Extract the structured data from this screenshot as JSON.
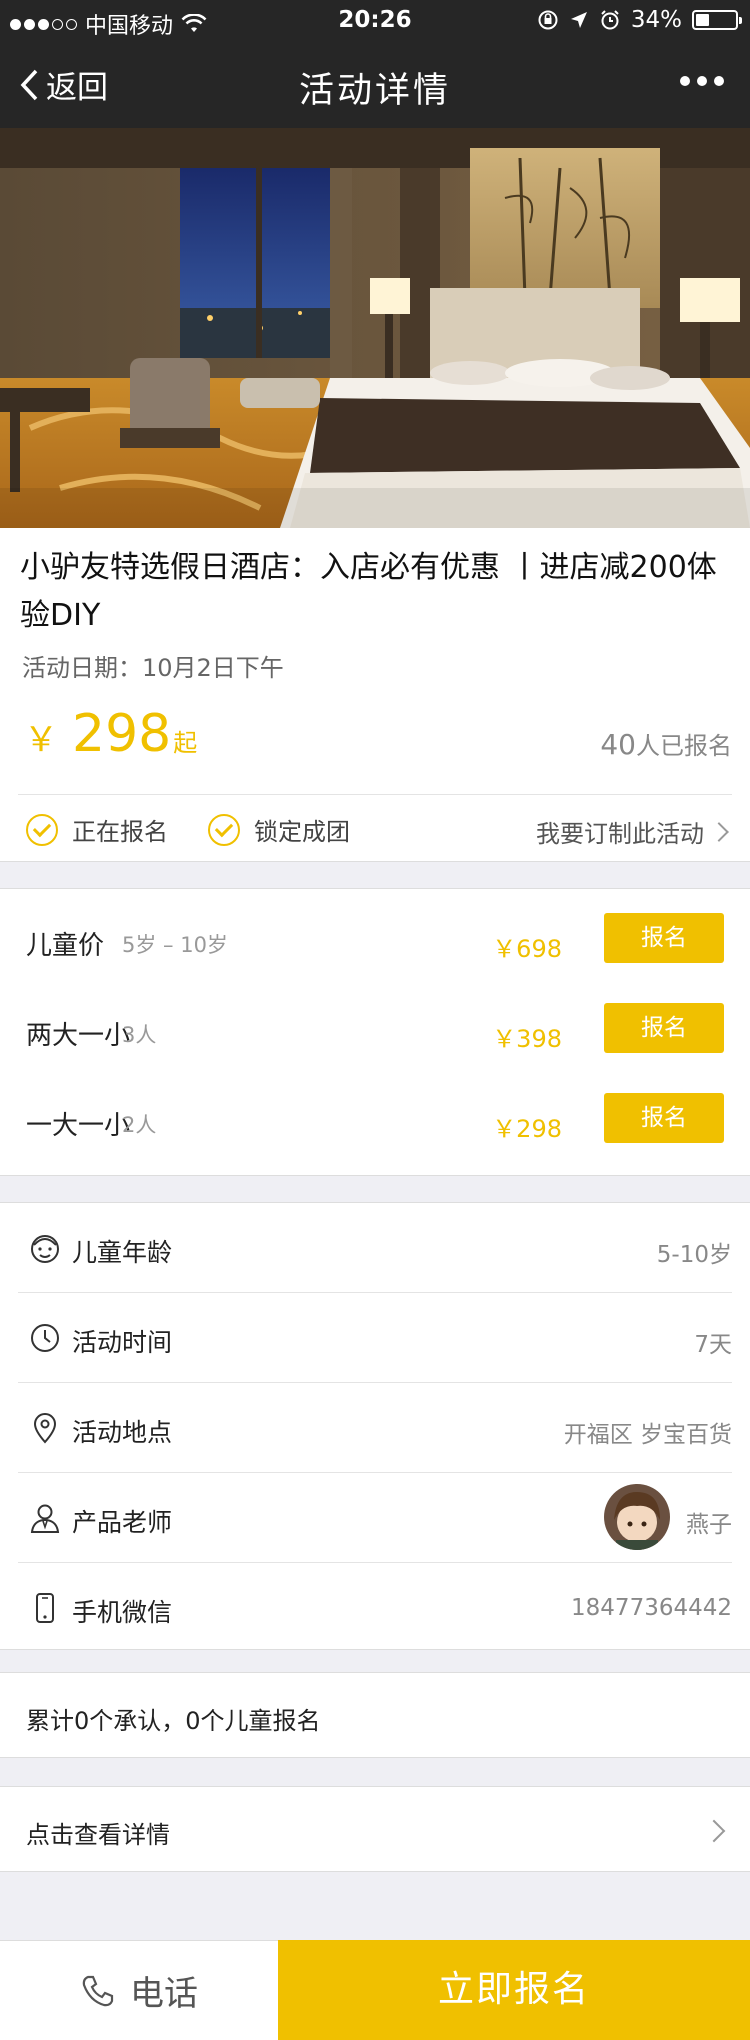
{
  "status_bar": {
    "carrier": "中国移动",
    "time": "20:26",
    "battery": "34%",
    "battery_level": 0.34
  },
  "nav": {
    "back_label": "返回",
    "title": "活动详情"
  },
  "activity": {
    "title": "小驴友特选假日酒店：入店必有优惠 丨进店减200体验DIY",
    "date": "活动日期：10月2日下午",
    "currency": "￥",
    "price": "298",
    "price_suffix": "起",
    "enrolled_count": "40",
    "enrolled_text": "人已报名",
    "tags": [
      "正在报名",
      "锁定成团"
    ],
    "order_link": "我要订制此活动"
  },
  "pricing": [
    {
      "name": "儿童价",
      "sub": "5岁 – 10岁",
      "amount": "￥698",
      "button": "报名"
    },
    {
      "name": "两大一小",
      "sub": "3人",
      "amount": "￥398",
      "button": "报名"
    },
    {
      "name": "一大一小",
      "sub": "2人",
      "amount": "￥298",
      "button": "报名"
    }
  ],
  "details": [
    {
      "icon": "child-face-icon",
      "label": "儿童年龄",
      "value": "5-10岁"
    },
    {
      "icon": "clock-icon",
      "label": "活动时间",
      "value": "7天"
    },
    {
      "icon": "location-pin-icon",
      "label": "活动地点",
      "value": "开福区 岁宝百货"
    },
    {
      "icon": "teacher-icon",
      "label": "产品老师",
      "value": "燕子"
    },
    {
      "icon": "phone-icon",
      "label": "手机微信",
      "value": "18477364442"
    }
  ],
  "summary": "累计0个承认，0个儿童报名",
  "view_details": "点击查看详情",
  "bottom": {
    "call_label": "电话",
    "signup_label": "立即报名"
  },
  "colors": {
    "accent": "#f0c000",
    "nav_bg": "#262626",
    "page_bg": "#efeff4"
  }
}
